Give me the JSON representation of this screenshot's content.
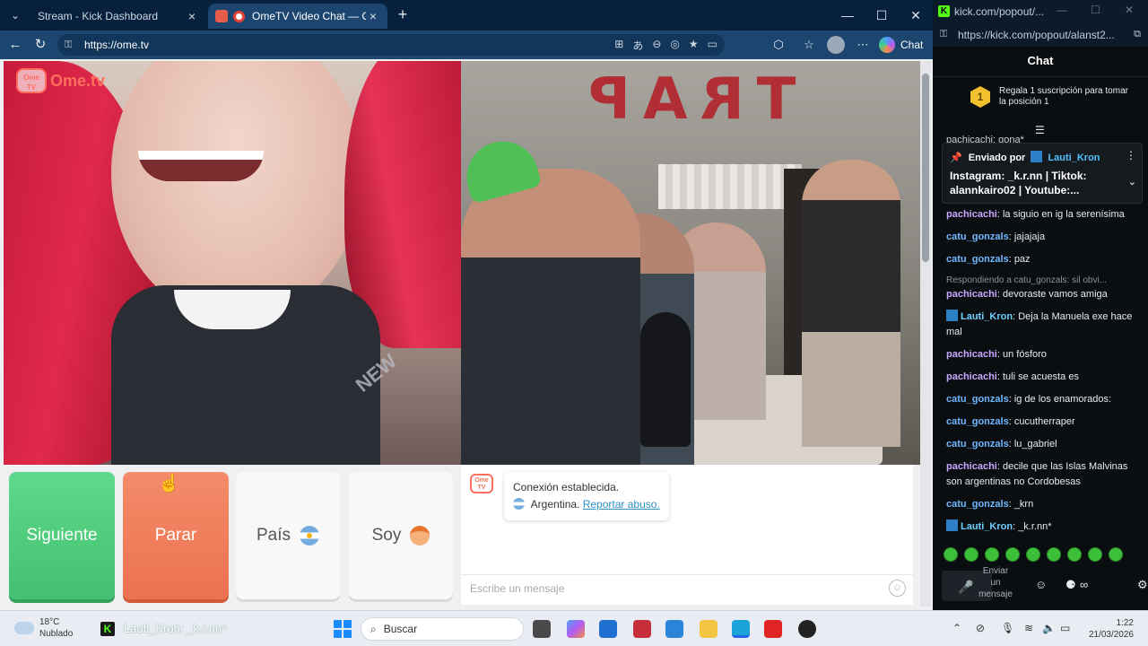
{
  "browser": {
    "tabs": [
      {
        "label": "Stream - Kick Dashboard",
        "active": false
      },
      {
        "label": "OmeTV Video Chat — Omegle",
        "active": true
      }
    ],
    "url": "https://ome.tv",
    "chat_label": "Chat"
  },
  "ome": {
    "logo_word": "Ome.tv",
    "logo_bubble": "Ome TV",
    "wall_text": "TRAP",
    "buttons": {
      "next": "Siguiente",
      "stop": "Parar",
      "country": "País",
      "gender": "Soy"
    },
    "system_message": {
      "line1": "Conexión establecida.",
      "country": "Argentina.",
      "report_link": "Reportar abuso."
    },
    "input_placeholder": "Escribe un mensaje"
  },
  "kick": {
    "window_url": "kick.com/popout/...",
    "address": "https://kick.com/popout/alanst2...",
    "header": "Chat",
    "gift": {
      "badge": "1",
      "text": "Regala 1 suscripción para tomar la posición 1"
    },
    "peek": "pachicachi: gona*",
    "pinned": {
      "prefix": "Enviado por",
      "user": "Lauti_Kron",
      "text": "Instagram: _k.r.nn | Tiktok: alannkairo02 | Youtube:..."
    },
    "messages": [
      {
        "user": "pachicachi",
        "color": "#c9a6ff",
        "text": "la siguio en ig la serenísima",
        "badge": false
      },
      {
        "user": "catu_gonzals",
        "color": "#6fb8ff",
        "text": "jajajaja",
        "badge": false
      },
      {
        "user": "catu_gonzals",
        "color": "#6fb8ff",
        "text": "paz",
        "badge": false
      },
      {
        "reply": "Respondiendo a catu_gonzals: sil obvi..."
      },
      {
        "user": "pachicachi",
        "color": "#c9a6ff",
        "text": "devoraste vamos amiga",
        "badge": false
      },
      {
        "user": "Lauti_Kron",
        "color": "#6fd0ff",
        "text": "Deja la Manuela exe hace mal",
        "badge": true
      },
      {
        "user": "pachicachi",
        "color": "#c9a6ff",
        "text": "un fósforo",
        "badge": false
      },
      {
        "user": "pachicachi",
        "color": "#c9a6ff",
        "text": "tuli se acuesta es",
        "badge": false
      },
      {
        "user": "catu_gonzals",
        "color": "#6fb8ff",
        "text": "ig de los enamorados:",
        "badge": false
      },
      {
        "user": "catu_gonzals",
        "color": "#6fb8ff",
        "text": "cucutherraper",
        "badge": false
      },
      {
        "user": "catu_gonzals",
        "color": "#6fb8ff",
        "text": "lu_gabriel",
        "badge": false
      },
      {
        "user": "pachicachi",
        "color": "#c9a6ff",
        "text": "decile que las Islas Malvinas son argentinas no Cordobesas",
        "badge": false
      },
      {
        "user": "catu_gonzals",
        "color": "#6fb8ff",
        "text": "_krn",
        "badge": false
      },
      {
        "user": "Lauti_Kron",
        "color": "#6fd0ff",
        "text": "_k.r.nn*",
        "badge": true
      }
    ],
    "send_label": "Enviar un mensaje"
  },
  "taskbar": {
    "temp": "18°C",
    "weather": "Nublado",
    "kick_window": "Lauti_Kron: _k.r.nn*",
    "search": "Buscar",
    "time": "1:22",
    "date": "21/03/2026"
  }
}
